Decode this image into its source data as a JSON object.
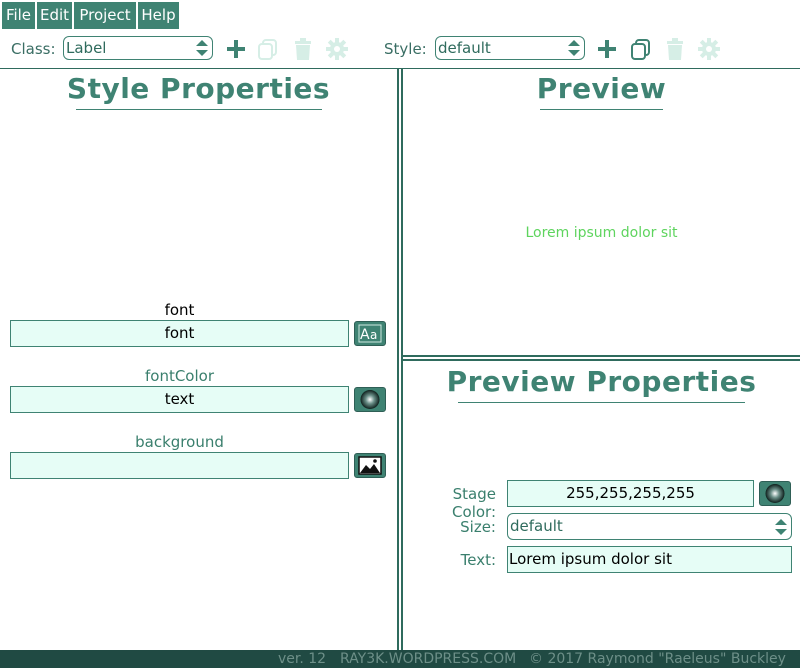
{
  "menu": {
    "file": "File",
    "edit": "Edit",
    "project": "Project",
    "help": "Help"
  },
  "toolbar": {
    "class_label": "Class:",
    "class_value": "Label",
    "style_label": "Style:",
    "style_value": "default"
  },
  "style_panel": {
    "title": "Style Properties",
    "props": [
      {
        "label": "font",
        "value": "font",
        "icon": "font-icon"
      },
      {
        "label": "fontColor",
        "value": "text",
        "icon": "color-wheel-icon"
      },
      {
        "label": "background",
        "value": "",
        "icon": "image-icon"
      }
    ]
  },
  "preview_panel": {
    "title": "Preview",
    "sample_text": "Lorem ipsum dolor sit",
    "sample_color": "#5ed45e"
  },
  "preview_props": {
    "title": "Preview Properties",
    "stage_color_label": "Stage Color:",
    "stage_color_value": "255,255,255,255",
    "size_label": "Size:",
    "size_value": "default",
    "text_label": "Text:",
    "text_value": "Lorem ipsum dolor sit"
  },
  "status": {
    "version": "ver. 12",
    "site": "RAY3K.WORDPRESS.COM",
    "copyright": "© 2017 Raymond \"Raeleus\" Buckley"
  },
  "colors": {
    "accent": "#3f8373",
    "dark": "#204a43",
    "field_bg": "#e6fdf6",
    "disabled_icon": "#d6eee6"
  }
}
